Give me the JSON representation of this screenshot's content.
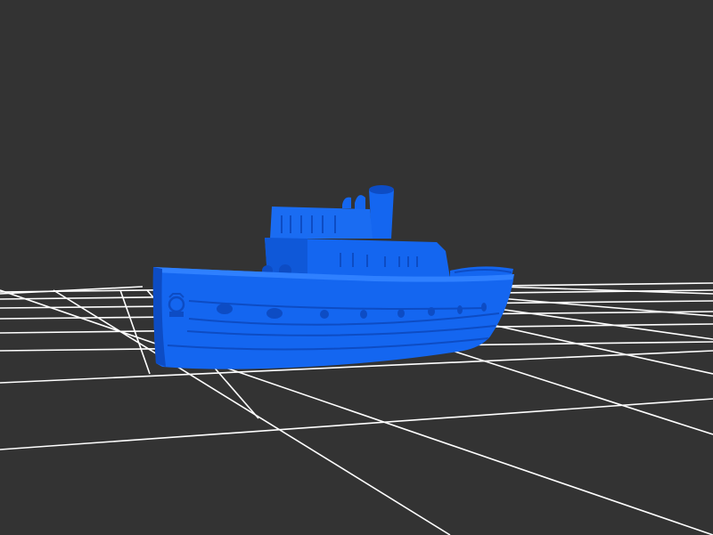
{
  "viewer": {
    "background_color": "#333333",
    "grid_color": "#ffffff",
    "model_color": "#1466f0",
    "model_shade_dark": "#0d4cc4",
    "model_shade_light": "#2f80ff",
    "model_name": "",
    "projection": "perspective",
    "ground_grid_visible": true
  }
}
